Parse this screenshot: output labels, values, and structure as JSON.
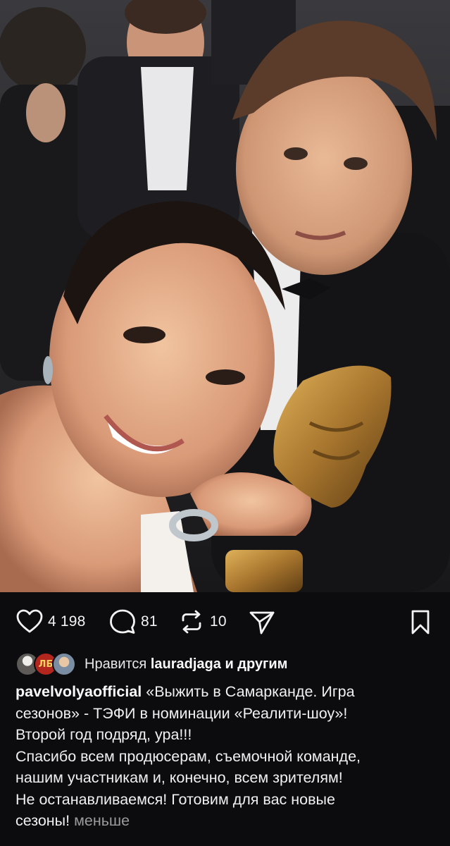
{
  "post": {
    "photo": {
      "description_icon": "photo-icon"
    },
    "actions": {
      "likes_count": "4 198",
      "comments_count": "81",
      "reposts_count": "10"
    },
    "liked_by": {
      "prefix": "Нравится",
      "user": "lauradjaga",
      "suffix": "и другим",
      "avatar_badge": "ЛБ"
    },
    "caption": {
      "username": "pavelvolyaofficial",
      "lines": [
        "«Выжить в Самарканде. Игра",
        "сезонов» - ТЭФИ  в номинации «Реалити-шоу»!",
        "Второй год подряд, ура!!!",
        "Спасибо всем продюсерам, съемочной команде,",
        "нашим участникам и, конечно, всем зрителям!",
        "Не останавливаемся! Готовим для вас новые",
        "сезоны!"
      ],
      "less_label": "меньше"
    }
  },
  "colors": {
    "background": "#000000",
    "panel": "#0c0c0e",
    "text": "#f0f0f0",
    "muted": "#9b9b9b",
    "award_gold": "#b8893a"
  }
}
